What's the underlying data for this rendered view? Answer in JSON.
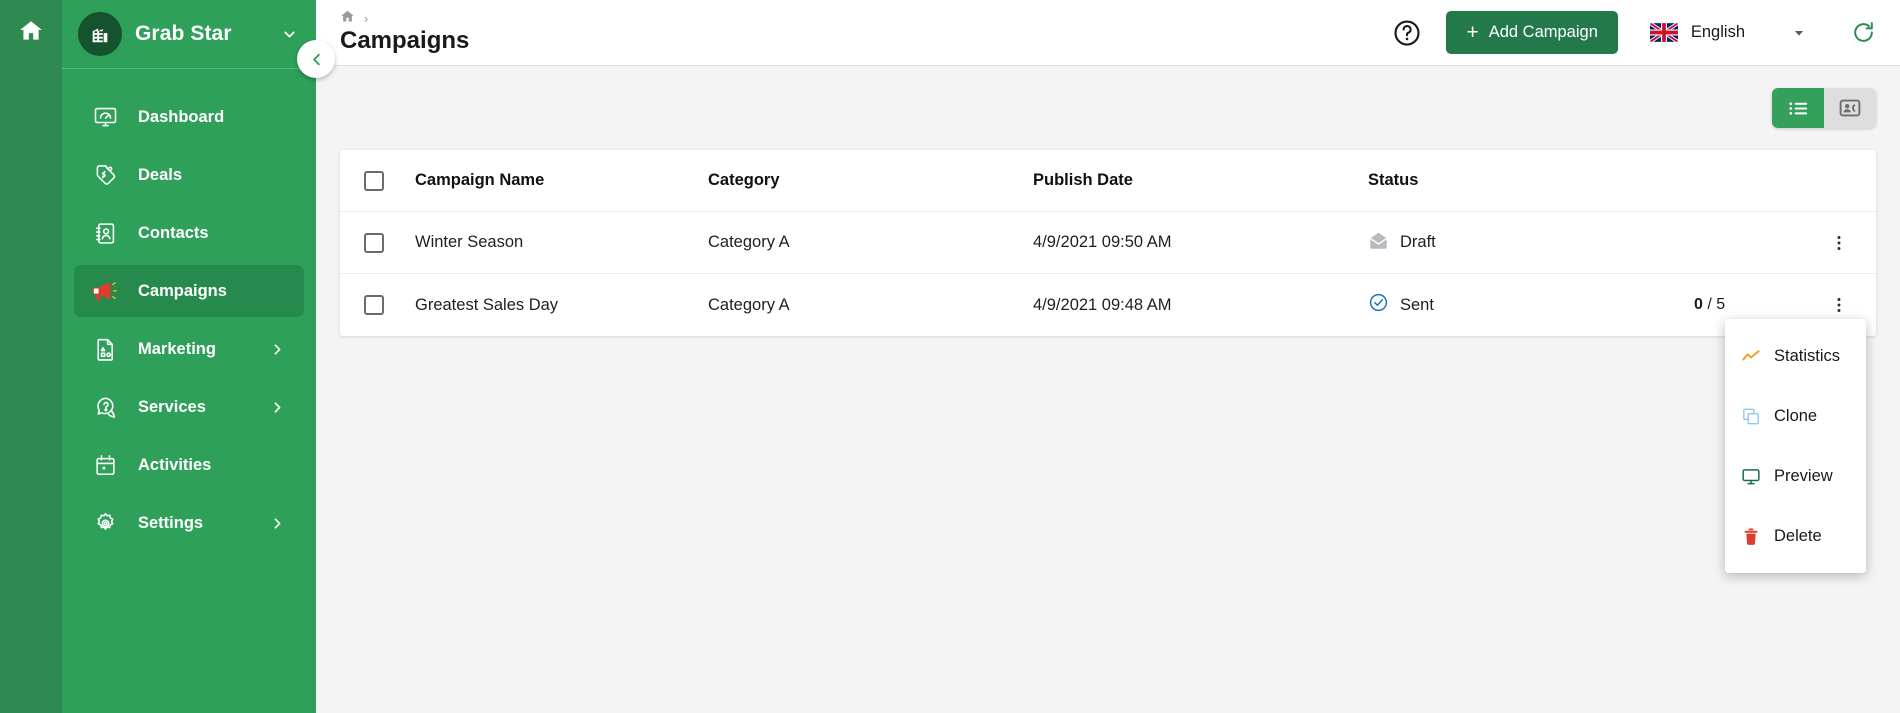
{
  "colors": {
    "rail_green": "#2f8a52",
    "sidebar_green": "#2ea05a",
    "sidebar_active_green": "#268a4d",
    "button_green": "#23794a",
    "toggle_green": "#35a05b",
    "accent_red": "#e03b2f",
    "status_sent_blue": "#1a73c4",
    "status_draft_gray": "#b7bcc0",
    "statistics_orange": "#f0a020",
    "clone_blue": "#8ecaf0",
    "preview_green": "#1d6b4a",
    "page_bg": "#f4f4f4"
  },
  "rail": {
    "home_icon": "home-icon"
  },
  "sidebar": {
    "org_name": "Grab Star",
    "org_logo_icon": "building-icon",
    "org_caret_icon": "chevron-down-icon",
    "collapse_icon": "chevron-left-icon",
    "items": [
      {
        "label": "Dashboard",
        "icon": "dashboard-monitor-icon",
        "active": false,
        "expandable": false
      },
      {
        "label": "Deals",
        "icon": "price-tag-icon",
        "active": false,
        "expandable": false
      },
      {
        "label": "Contacts",
        "icon": "address-book-icon",
        "active": false,
        "expandable": false
      },
      {
        "label": "Campaigns",
        "icon": "megaphone-icon",
        "active": true,
        "expandable": false
      },
      {
        "label": "Marketing",
        "icon": "document-shapes-icon",
        "active": false,
        "expandable": true
      },
      {
        "label": "Services",
        "icon": "question-chat-icon",
        "active": false,
        "expandable": true
      },
      {
        "label": "Activities",
        "icon": "calendar-icon",
        "active": false,
        "expandable": false
      },
      {
        "label": "Settings",
        "icon": "gear-icon",
        "active": false,
        "expandable": true
      }
    ]
  },
  "topbar": {
    "breadcrumb_home_icon": "home-icon",
    "breadcrumb_separator": "›",
    "page_title": "Campaigns",
    "help_icon": "question-circle-icon",
    "add_button_label": "Add Campaign",
    "add_button_plus": "+",
    "language_label": "English",
    "language_flag": "uk-flag-icon",
    "language_caret_icon": "caret-down-icon",
    "refresh_icon": "refresh-icon"
  },
  "view_toggle": {
    "list_view_icon": "list-view-icon",
    "card_view_icon": "contact-card-view-icon",
    "active": "list"
  },
  "table": {
    "columns": [
      "Campaign Name",
      "Category",
      "Publish Date",
      "Status"
    ],
    "rows": [
      {
        "name": "Winter Season",
        "category": "Category A",
        "publish_date": "4/9/2021 09:50 AM",
        "status": "Draft",
        "status_icon": "envelope-open-icon",
        "count_sent": "",
        "count_sep": "",
        "count_total": ""
      },
      {
        "name": "Greatest Sales Day",
        "category": "Category A",
        "publish_date": "4/9/2021 09:48 AM",
        "status": "Sent",
        "status_icon": "check-circle-icon",
        "count_sent": "0",
        "count_sep": "/",
        "count_total": "5"
      }
    ],
    "kebab_icon": "more-vertical-icon"
  },
  "context_menu": {
    "open": true,
    "items": [
      {
        "label": "Statistics",
        "icon": "line-chart-icon"
      },
      {
        "label": "Clone",
        "icon": "copy-icon"
      },
      {
        "label": "Preview",
        "icon": "monitor-icon"
      },
      {
        "label": "Delete",
        "icon": "trash-icon"
      }
    ]
  }
}
